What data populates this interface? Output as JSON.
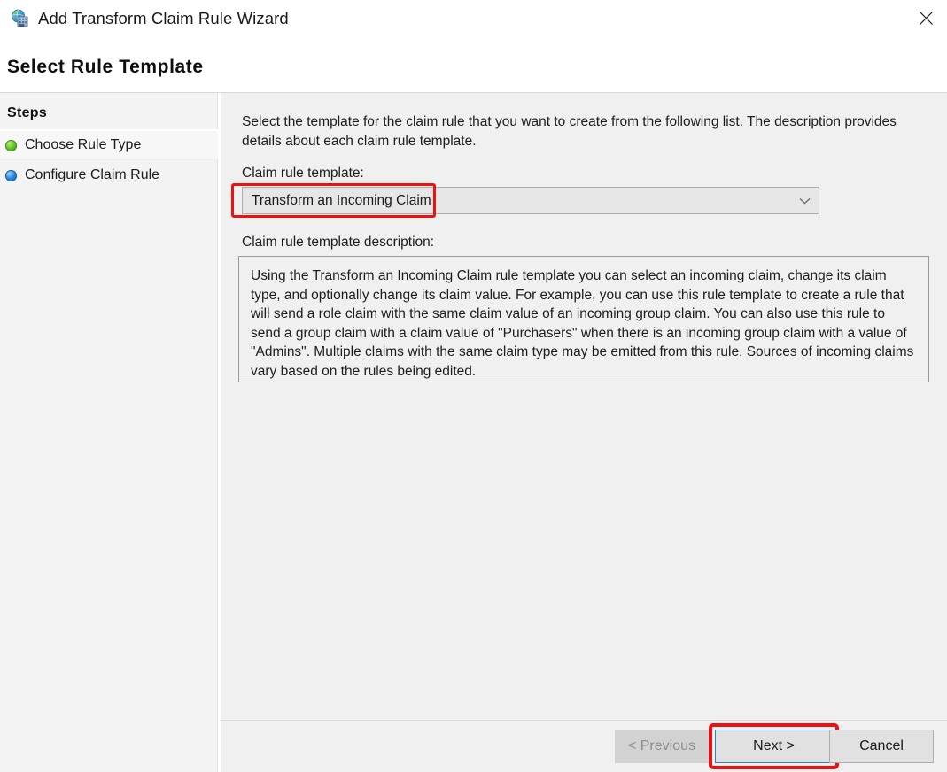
{
  "window": {
    "title": "Add Transform Claim Rule Wizard",
    "app_icon": "adfs-claim-rule-icon",
    "close_icon": "close-icon"
  },
  "page": {
    "heading": "Select Rule Template"
  },
  "sidebar": {
    "title": "Steps",
    "items": [
      {
        "label": "Choose Rule Type",
        "bullet": "green",
        "state": "completed"
      },
      {
        "label": "Configure Claim Rule",
        "bullet": "blue",
        "state": "current"
      }
    ]
  },
  "main": {
    "intro": "Select the template for the claim rule that you want to create from the following list. The description provides details about each claim rule template.",
    "template_label": "Claim rule template:",
    "template_value": "Transform an Incoming Claim",
    "template_dropdown_icon": "chevron-down-icon",
    "description_label": "Claim rule template description:",
    "description_text": "Using the Transform an Incoming Claim rule template you can select an incoming claim, change its claim type, and optionally change its claim value.  For example, you can use this rule template to create a rule that will send a role claim with the same claim value of an incoming group claim.  You can also use this rule to send a group claim with a claim value of \"Purchasers\" when there is an incoming group claim with a value of \"Admins\".  Multiple claims with the same claim type may be emitted from this rule.  Sources of incoming claims vary based on the rules being edited."
  },
  "footer": {
    "previous_label": "< Previous",
    "next_label": "Next >",
    "cancel_label": "Cancel"
  },
  "annotations": {
    "highlight_color": "#ee1111",
    "focus_color": "#1f8ad2",
    "targets": [
      "template_value",
      "next_button"
    ]
  }
}
